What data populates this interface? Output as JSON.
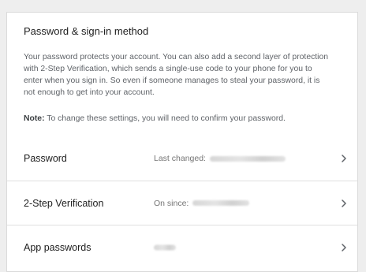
{
  "section": {
    "title": "Password & sign-in method",
    "description": "Your password protects your account. You can also add a second layer of protection with 2-Step Verification, which sends a single-use code to your phone for you to enter when you sign in. So even if someone manages to steal your password, it is not enough to get into your account.",
    "note_label": "Note:",
    "note_text": " To change these settings, you will need to confirm your password."
  },
  "rows": [
    {
      "label": "Password",
      "value_label": "Last changed:"
    },
    {
      "label": "2-Step Verification",
      "value_label": "On since:"
    },
    {
      "label": "App passwords",
      "value_label": ""
    }
  ],
  "icons": {
    "row_chevron": "chevron-right-icon"
  },
  "colors": {
    "background": "#eeeeee",
    "card": "#ffffff",
    "divider": "#e0e0e0",
    "primary_text": "#212121",
    "secondary_text": "#5f6368"
  }
}
